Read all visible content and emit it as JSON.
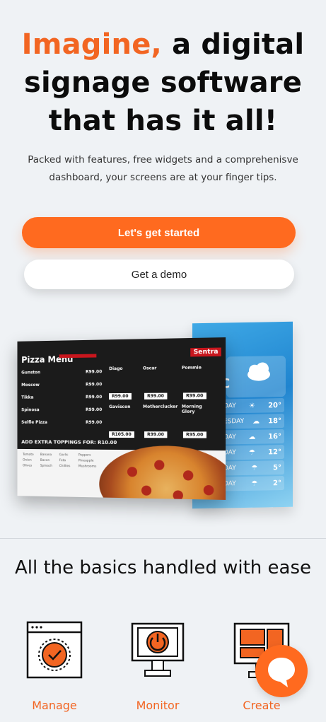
{
  "hero": {
    "title_accent": "Imagine,",
    "title_rest": "a digital signage software that has it all!",
    "subtitle": "Packed with features, free widgets and a comprehenisve dashboard, your screens are at your finger tips."
  },
  "buttons": {
    "primary_label": "Let's get started",
    "secondary_label": "Get a demo"
  },
  "menu_board": {
    "title": "Pizza Menu",
    "brand": "Sentra",
    "items": [
      {
        "name": "Gunston",
        "price": "R99.00"
      },
      {
        "name": "Moscow",
        "price": "R99.00"
      },
      {
        "name": "Tikka",
        "price": "R99.00"
      },
      {
        "name": "Spinosa",
        "price": "R99.00"
      },
      {
        "name": "Selfie Pizza",
        "price": "R99.00"
      }
    ],
    "grid": [
      {
        "name": "Diago",
        "price": "R99.00"
      },
      {
        "name": "Oscar",
        "price": "R99.00"
      },
      {
        "name": "Pommie",
        "price": "R99.00"
      },
      {
        "name": "Gaviscon",
        "price": "R105.00"
      },
      {
        "name": "Motherclucker",
        "price": "R99.00"
      },
      {
        "name": "Morning Glory",
        "price": "R95.00"
      }
    ],
    "extra_label": "ADD EXTRA TOPPINGS FOR:",
    "extra_price": "R10.00",
    "toppings": [
      "Tomato",
      "Banana",
      "Garlic",
      "Peppers",
      "Onion",
      "Bacon",
      "Feta",
      "Pineapple",
      "Olives",
      "Spinach",
      "Chillies",
      "Mushrooms"
    ]
  },
  "weather_board": {
    "letter": "C",
    "rows": [
      {
        "day": "DAY",
        "temp": "20°",
        "icon": "sun-icon"
      },
      {
        "day": "ESDAY",
        "temp": "18°",
        "icon": "cloud-icon"
      },
      {
        "day": "DAY",
        "temp": "16°",
        "icon": "cloud-icon"
      },
      {
        "day": "DAY",
        "temp": "12°",
        "icon": "rain-icon"
      },
      {
        "day": "DAY",
        "temp": "5°",
        "icon": "rain-icon"
      },
      {
        "day": "DAY",
        "temp": "2°",
        "icon": "rain-icon"
      }
    ]
  },
  "basics": {
    "title": "All the basics handled with ease"
  },
  "features": [
    {
      "label": "Manage",
      "icon": "manage-icon"
    },
    {
      "label": "Monitor",
      "icon": "monitor-icon"
    },
    {
      "label": "Create",
      "icon": "create-icon"
    }
  ],
  "colors": {
    "accent": "#f26522",
    "button": "#ff6a1f",
    "background": "#eff2f5"
  }
}
